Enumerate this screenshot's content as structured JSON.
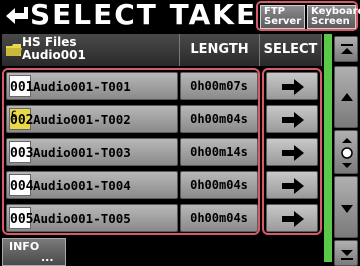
{
  "header": {
    "title": "SELECT TAKE",
    "ftp_label": "FTP Server",
    "keyboard_label": "Keyboard Screen"
  },
  "columns": {
    "folder_name": "HS Files",
    "folder_sub": "Audio001",
    "length": "LENGTH",
    "select": "SELECT"
  },
  "takes": [
    {
      "icon_number": "001",
      "name": "Audio001-T001",
      "length": "0h00m07s",
      "current": false
    },
    {
      "icon_number": "002",
      "name": "Audio001-T002",
      "length": "0h00m04s",
      "current": true
    },
    {
      "icon_number": "003",
      "name": "Audio001-T003",
      "length": "0h00m14s",
      "current": false
    },
    {
      "icon_number": "004",
      "name": "Audio001-T004",
      "length": "0h00m04s",
      "current": false
    },
    {
      "icon_number": "005",
      "name": "Audio001-T005",
      "length": "0h00m04s",
      "current": false
    }
  ],
  "current_mark": "C",
  "footer": {
    "info_label": "INFO",
    "info_dots": "..."
  },
  "colors": {
    "highlight_frame": "#d65a6a",
    "scroll_track": "#5cc84a",
    "current_icon": "#e8d84a"
  }
}
